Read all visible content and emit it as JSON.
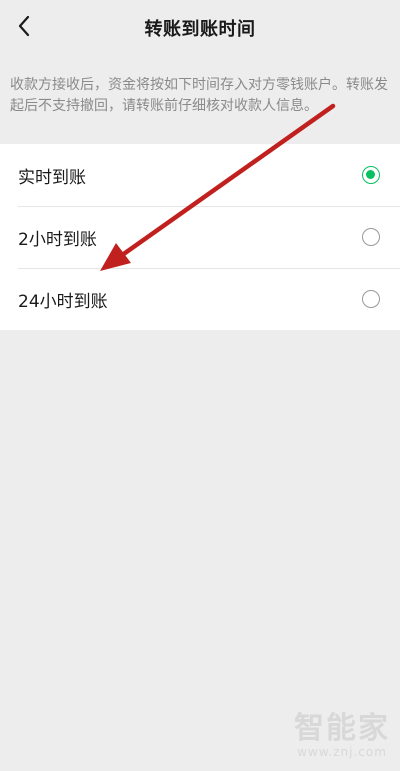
{
  "header": {
    "title": "转账到账时间",
    "back_icon": "chevron-left-icon"
  },
  "notice": {
    "text": "收款方接收后，资金将按如下时间存入对方零钱账户。转账发起后不支持撤回，请转账前仔细核对收款人信息。"
  },
  "options": [
    {
      "label": "实时到账",
      "selected": true
    },
    {
      "label": "2小时到账",
      "selected": false
    },
    {
      "label": "24小时到账",
      "selected": false
    }
  ],
  "annotation": {
    "type": "arrow",
    "color": "#c0211e"
  },
  "watermark": {
    "logo": "智能家",
    "url": "www.znj.com"
  },
  "colors": {
    "accent": "#07c160",
    "background": "#ededed",
    "card": "#ffffff",
    "muted_text": "#8a8a8a"
  }
}
